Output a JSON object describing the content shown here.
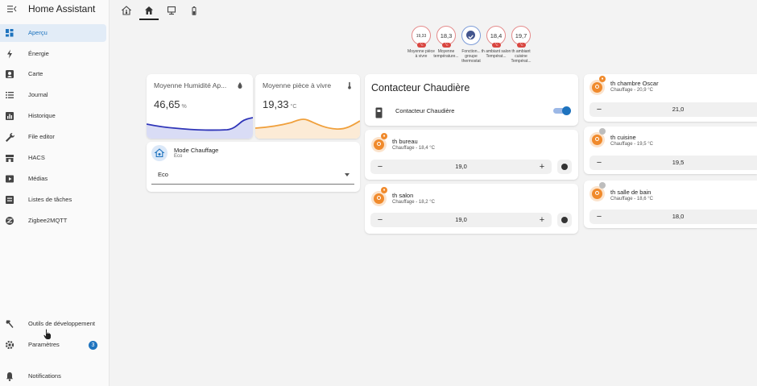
{
  "app": {
    "title": "Home Assistant"
  },
  "sidebar": {
    "items": [
      {
        "label": "Aperçu",
        "icon": "dashboard-icon",
        "active": true
      },
      {
        "label": "Énergie",
        "icon": "lightning-icon"
      },
      {
        "label": "Carte",
        "icon": "map-icon"
      },
      {
        "label": "Journal",
        "icon": "list-icon"
      },
      {
        "label": "Historique",
        "icon": "chart-icon"
      },
      {
        "label": "File editor",
        "icon": "wrench-icon"
      },
      {
        "label": "HACS",
        "icon": "hacs-icon"
      },
      {
        "label": "Médias",
        "icon": "media-icon"
      },
      {
        "label": "Listes de tâches",
        "icon": "checklist-icon"
      },
      {
        "label": "Zigbee2MQTT",
        "icon": "zigbee-icon"
      }
    ],
    "bottom": {
      "dev_tools": "Outils de développement",
      "settings": "Paramètres",
      "settings_badge": "3",
      "notifications": "Notifications"
    }
  },
  "view_tabs": [
    "home-thermometer-icon",
    "home-icon",
    "monitor-icon",
    "battery-icon"
  ],
  "badges": [
    {
      "value": "19,33",
      "unit": "°c",
      "label": "Moyenne pièce à vivre"
    },
    {
      "value": "18,3",
      "unit": "°c",
      "label": "Moyenne température..."
    },
    {
      "value": "",
      "unit": "",
      "label": "Fonction... groupe thermostat",
      "check": true
    },
    {
      "value": "18,4",
      "unit": "°c",
      "label": "th ambiant salon Températ..."
    },
    {
      "value": "19,7",
      "unit": "°c",
      "label": "th ambiant cuisine Températ..."
    }
  ],
  "sensor_cards": [
    {
      "name": "Moyenne Humidité Ap...",
      "value": "46,65",
      "unit": "%",
      "icon": "water-drop-icon"
    },
    {
      "name": "Moyenne pièce à vivre",
      "value": "19,33",
      "unit": "°C",
      "icon": "thermometer-icon"
    }
  ],
  "mode_card": {
    "title": "Mode Chauffage",
    "subtitle": "Eco",
    "selected": "Eco"
  },
  "chaudiere_card": {
    "title": "Contacteur Chaudière",
    "switch_label": "Contacteur Chaudière",
    "switch_on": true
  },
  "thermostats_mid": [
    {
      "name": "th bureau",
      "state": "Chauffage - 18,4 °C",
      "setpoint": "19,0"
    },
    {
      "name": "th salon",
      "state": "Chauffage - 18,2 °C",
      "setpoint": "19,0"
    }
  ],
  "thermostats_right": [
    {
      "name": "th chambre Oscar",
      "state": "Chauffage - 20,9 °C",
      "setpoint": "21,0"
    },
    {
      "name": "th cuisine",
      "state": "Chauffage - 19,5 °C",
      "setpoint": "19,5"
    },
    {
      "name": "th salle de bain",
      "state": "Chauffage - 18,6 °C",
      "setpoint": "18,0"
    }
  ],
  "colors": {
    "accent": "#1e73be",
    "humidity_line": "#2f35b8",
    "temperature_line": "#f0a03c",
    "heating_orange": "#f08a2c",
    "badge_red": "#d9453f"
  }
}
